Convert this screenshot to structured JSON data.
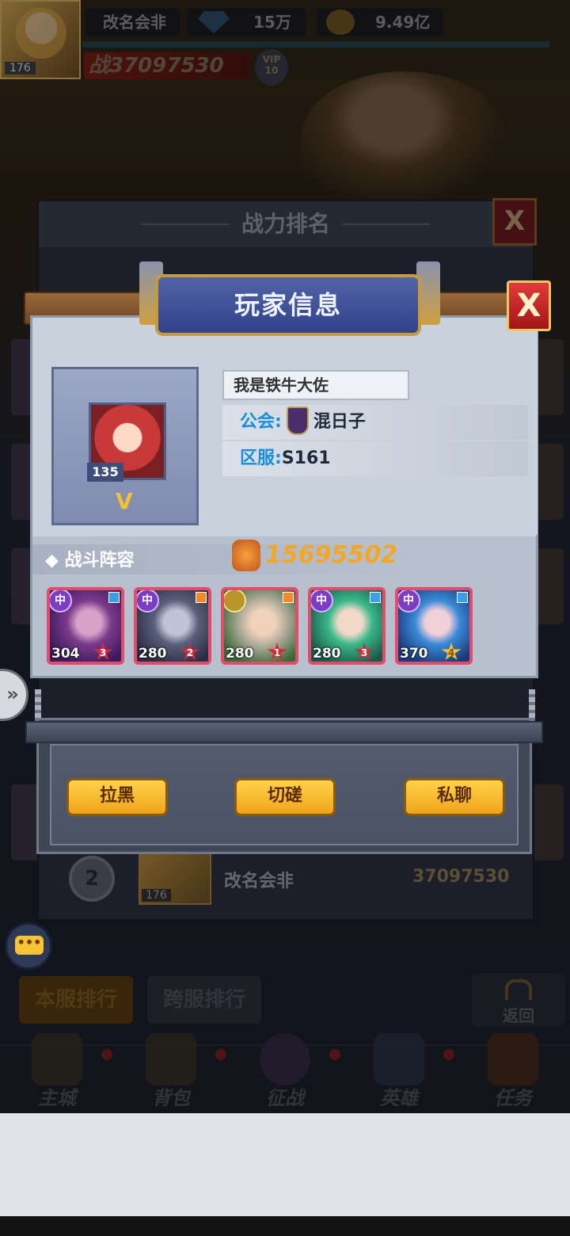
{
  "topbar": {
    "player_level": "176",
    "player_name": "改名会非",
    "gems": "15万",
    "gold": "9.49亿",
    "power": "战37097530",
    "vip": "VIP 10"
  },
  "rank_panel": {
    "title": "战力排名",
    "close_label": "X",
    "row2": {
      "rank": "2",
      "level": "176",
      "name": "改名会非",
      "power": "37097530"
    }
  },
  "tabs": {
    "local": "本服排行",
    "cross": "跨服排行",
    "back": "返回"
  },
  "nav": {
    "items": [
      {
        "label": "主城",
        "icon": "castle-icon"
      },
      {
        "label": "背包",
        "icon": "bag-icon"
      },
      {
        "label": "征战",
        "icon": "battle-portal-icon"
      },
      {
        "label": "英雄",
        "icon": "hero-helmet-icon"
      },
      {
        "label": "任务",
        "icon": "scroll-icon"
      }
    ]
  },
  "player_info": {
    "title": "玩家信息",
    "close_label": "X",
    "name": "我是铁牛大佐",
    "level": "135",
    "vip_mark": "V",
    "guild_key": "公会:",
    "guild_value": "混日子",
    "server_key": "区服:",
    "server_value": "S161",
    "lineup_title": "战斗阵容",
    "lineup_power": "15695502",
    "heroes": [
      {
        "level": "304",
        "stars": "3",
        "faction": "中",
        "faction_color": "#7b3ec2",
        "class_color": "#3aa0e6"
      },
      {
        "level": "280",
        "stars": "2",
        "faction": "中",
        "faction_color": "#7b3ec2",
        "class_color": "#f08a2a"
      },
      {
        "level": "280",
        "stars": "1",
        "faction": "",
        "faction_color": "#b8952a",
        "class_color": "#f08a2a"
      },
      {
        "level": "280",
        "stars": "3",
        "faction": "中",
        "faction_color": "#7b3ec2",
        "class_color": "#3aa0e6"
      },
      {
        "level": "370",
        "stars": "4",
        "faction": "中",
        "faction_color": "#7b3ec2",
        "class_color": "#3aa0e6"
      }
    ],
    "actions": {
      "block": "拉黑",
      "duel": "切磋",
      "chat": "私聊"
    }
  },
  "colors": {
    "accent_gold": "#f5a623",
    "button_yellow": "#ffd24a",
    "close_red": "#e23a3a",
    "banner_blue": "#32428a"
  }
}
